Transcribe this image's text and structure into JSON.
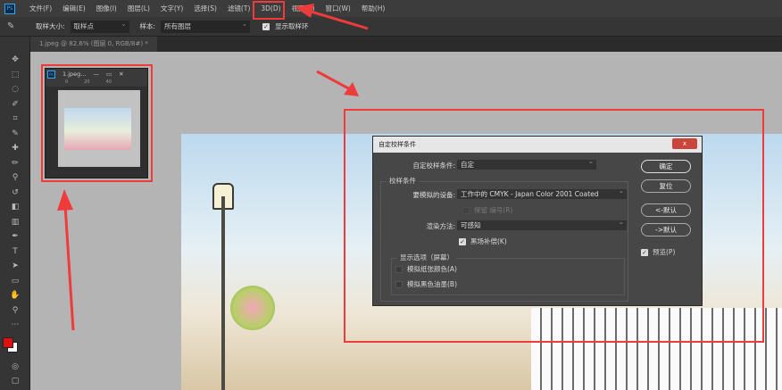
{
  "menubar": {
    "logo": "Ps",
    "items": [
      "文件(F)",
      "编辑(E)",
      "图像(I)",
      "图层(L)",
      "文字(Y)",
      "选择(S)",
      "滤镜(T)",
      "3D(D)",
      "视图(V)",
      "窗口(W)",
      "帮助(H)"
    ]
  },
  "optbar": {
    "sample_size_label": "取样大小:",
    "sample_size_value": "取样点",
    "sample_label": "样本:",
    "sample_value": "所有图层",
    "show_ring_label": "显示取样环"
  },
  "tab": {
    "label": "1.jpeg @ 82.6% (图层 0, RGB/8#) *"
  },
  "mini_window": {
    "title": "1.jpeg...",
    "ruler": [
      "0",
      "20",
      "40"
    ]
  },
  "dialog": {
    "title": "自定校样条件",
    "close": "x",
    "custom_label": "自定校样条件:",
    "custom_value": "自定",
    "group_proof": "校样条件",
    "device_label": "要模拟的设备:",
    "device_value": "工作中的 CMYK - Japan Color 2001 Coated",
    "preserve_label": "保留 编号(R)",
    "intent_label": "渲染方法:",
    "intent_value": "可感知",
    "bpc_label": "黑场补偿(K)",
    "group_display": "显示选项（屏幕）",
    "paper_label": "模拟纸张颜色(A)",
    "ink_label": "模拟黑色油墨(B)",
    "ok": "确定",
    "reset": "复位",
    "load": "<-默认",
    "save": "->默认",
    "preview_label": "预览(P)"
  },
  "colors": {
    "annotation": "#ef3b3b",
    "foreground": "#e01010",
    "workspace": "#b4b4b4"
  }
}
